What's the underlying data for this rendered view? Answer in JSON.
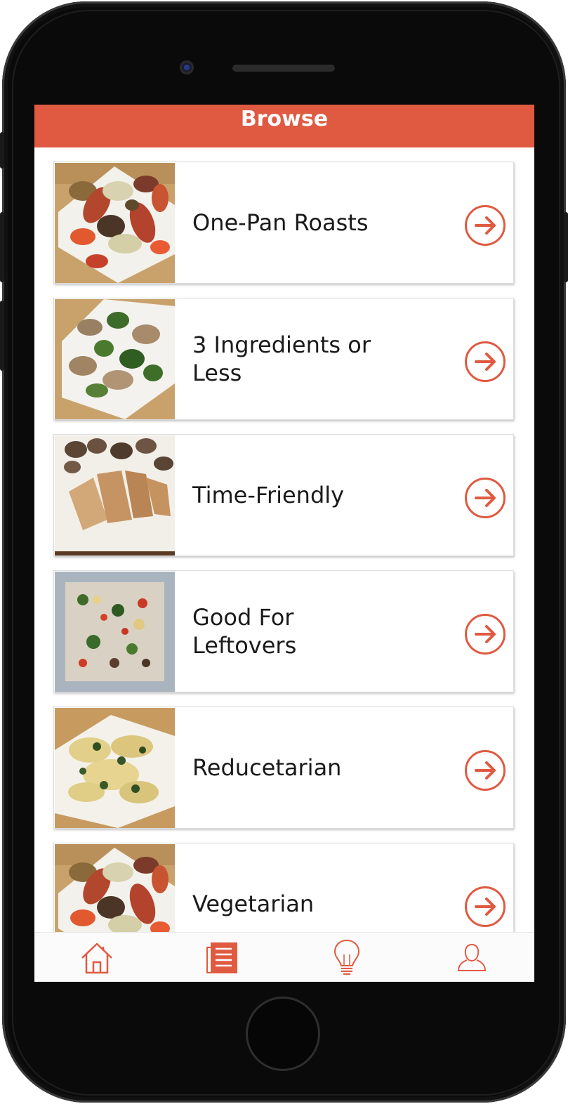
{
  "header": {
    "title": "Browse"
  },
  "categories": [
    {
      "label": "One-Pan Roasts",
      "image": "roasted-vegetables-sausage",
      "action_icon": "arrow-right-circle-icon"
    },
    {
      "label": "3 Ingredients or Less",
      "image": "chicken-broccoli",
      "action_icon": "arrow-right-circle-icon"
    },
    {
      "label": "Time-Friendly",
      "image": "chicken-mushrooms",
      "action_icon": "arrow-right-circle-icon"
    },
    {
      "label": "Good For Leftovers",
      "image": "rice-vegetable-bowl",
      "action_icon": "arrow-right-circle-icon"
    },
    {
      "label": "Reducetarian",
      "image": "rotini-spinach-pasta",
      "action_icon": "arrow-right-circle-icon"
    },
    {
      "label": "Vegetarian",
      "image": "roasted-vegetables-sausage",
      "action_icon": "arrow-right-circle-icon"
    }
  ],
  "tabbar": {
    "items": [
      {
        "name": "home",
        "icon": "home-icon",
        "active": false
      },
      {
        "name": "browse",
        "icon": "list-icon",
        "active": true
      },
      {
        "name": "tips",
        "icon": "lightbulb-icon",
        "active": false
      },
      {
        "name": "profile",
        "icon": "user-icon",
        "active": false
      }
    ]
  },
  "colors": {
    "accent": "#e05a41",
    "text": "#1a1a1a",
    "background": "#ffffff"
  }
}
